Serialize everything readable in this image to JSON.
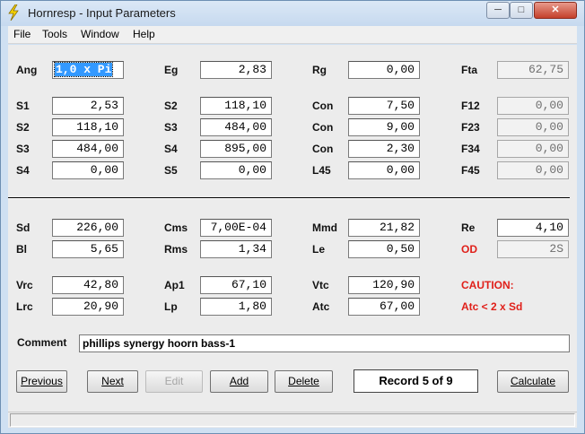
{
  "window": {
    "title": "Hornresp - Input Parameters"
  },
  "menu": [
    "File",
    "Tools",
    "Window",
    "Help"
  ],
  "labels": {
    "ang": "Ang",
    "eg": "Eg",
    "rg": "Rg",
    "fta": "Fta",
    "s1": "S1",
    "s2a": "S2",
    "con1": "Con",
    "f12": "F12",
    "s2": "S2",
    "s3a": "S3",
    "con2": "Con",
    "f23": "F23",
    "s3": "S3",
    "s4a": "S4",
    "con3": "Con",
    "f34": "F34",
    "s4": "S4",
    "s5": "S5",
    "l45": "L45",
    "f45": "F45",
    "sd": "Sd",
    "cms": "Cms",
    "mmd": "Mmd",
    "re": "Re",
    "bl": "Bl",
    "rms": "Rms",
    "le": "Le",
    "od": "OD",
    "vrc": "Vrc",
    "ap1": "Ap1",
    "vtc": "Vtc",
    "caution": "CAUTION:",
    "lrc": "Lrc",
    "lp": "Lp",
    "atc": "Atc",
    "caution_msg": "Atc < 2 x Sd",
    "comment": "Comment"
  },
  "values": {
    "ang": "1,0 x Pi",
    "eg": "2,83",
    "rg": "0,00",
    "fta": "62,75",
    "s1": "2,53",
    "s2a": "118,10",
    "con1": "7,50",
    "f12": "0,00",
    "s2": "118,10",
    "s3a": "484,00",
    "con2": "9,00",
    "f23": "0,00",
    "s3": "484,00",
    "s4a": "895,00",
    "con3": "2,30",
    "f34": "0,00",
    "s4": "0,00",
    "s5": "0,00",
    "l45": "0,00",
    "f45": "0,00",
    "sd": "226,00",
    "cms": "7,00E-04",
    "mmd": "21,82",
    "re": "4,10",
    "bl": "5,65",
    "rms": "1,34",
    "le": "0,50",
    "od": "2S",
    "vrc": "42,80",
    "ap1": "67,10",
    "vtc": "120,90",
    "lrc": "20,90",
    "lp": "1,80",
    "atc": "67,00",
    "comment": "phillips synergy hoorn bass-1"
  },
  "buttons": {
    "previous": "Previous",
    "next": "Next",
    "edit": "Edit",
    "add": "Add",
    "delete": "Delete",
    "calculate": "Calculate"
  },
  "record": "Record 5 of 9",
  "colors": {
    "caution": "#e0201a",
    "selection": "#3399ff"
  }
}
